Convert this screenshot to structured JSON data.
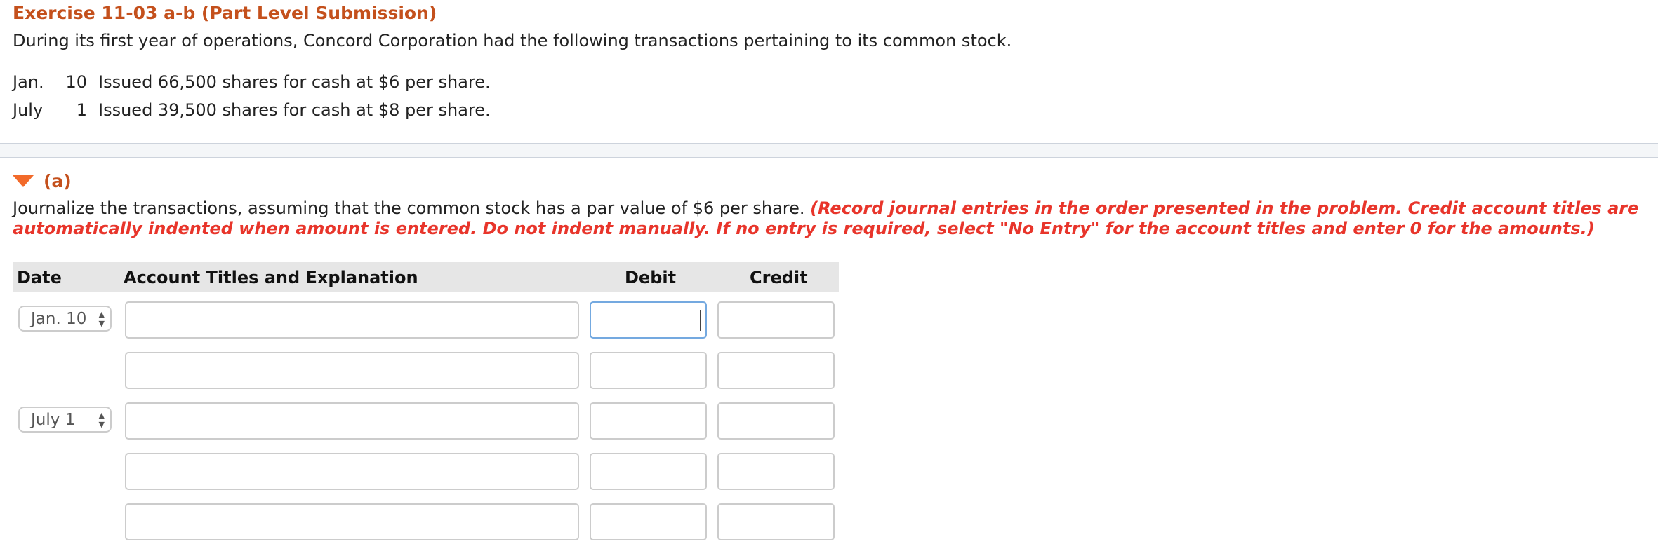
{
  "header": {
    "title": "Exercise 11-03 a-b (Part Level Submission)",
    "intro": "During its first year of operations, Concord Corporation had the following transactions pertaining to its common stock."
  },
  "transactions": [
    {
      "month": "Jan.",
      "day": "10",
      "text": "Issued 66,500 shares for cash at $6 per share."
    },
    {
      "month": "July",
      "day": "1",
      "text": "Issued 39,500 shares for cash at $8 per share."
    }
  ],
  "part": {
    "label": "(a)",
    "instruction": "Journalize the transactions, assuming that the common stock has a par value of $6 per share. ",
    "instruction_note": "(Record journal entries in the order presented in the problem. Credit account titles are automatically indented when amount is entered. Do not indent manually. If no entry is required, select \"No Entry\" for the account titles and enter 0 for the amounts.)"
  },
  "table": {
    "columns": {
      "date": "Date",
      "account": "Account Titles and Explanation",
      "debit": "Debit",
      "credit": "Credit"
    },
    "rows": [
      {
        "date": "Jan. 10",
        "account": "",
        "debit": "",
        "credit": "",
        "focused": "debit"
      },
      {
        "date": "",
        "account": "",
        "debit": "",
        "credit": ""
      },
      {
        "date": "July 1",
        "account": "",
        "debit": "",
        "credit": ""
      },
      {
        "date": "",
        "account": "",
        "debit": "",
        "credit": ""
      },
      {
        "date": "",
        "account": "",
        "debit": "",
        "credit": ""
      }
    ]
  },
  "colors": {
    "title": "#c4501c",
    "note": "#e8352b",
    "focus": "#74a9e0"
  }
}
